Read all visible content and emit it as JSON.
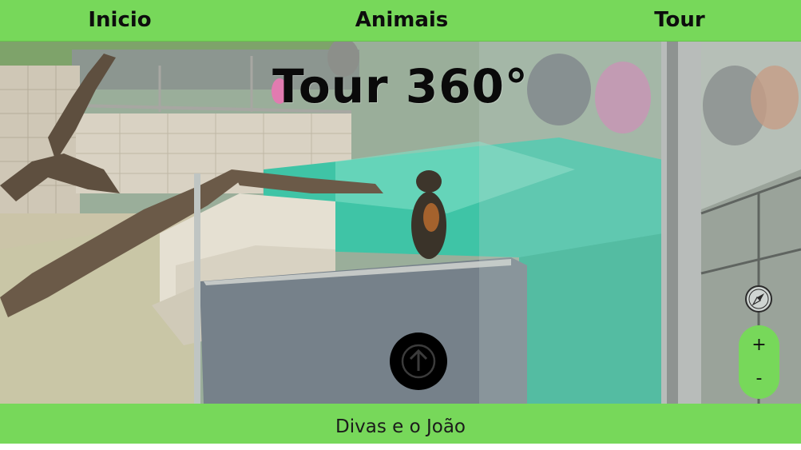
{
  "nav": {
    "inicio": "Inicio",
    "animais": "Animais",
    "tour": "Tour"
  },
  "panorama": {
    "title": "Tour 360°"
  },
  "controls": {
    "forward_icon": "arrow-up-icon",
    "compass_icon": "compass-icon",
    "zoom_in_label": "+",
    "zoom_out_label": "-"
  },
  "footer": {
    "text": "Divas e o João"
  },
  "colors": {
    "accent_green": "#77d85a",
    "water": "#3fc4a6",
    "button_black": "#000000"
  }
}
